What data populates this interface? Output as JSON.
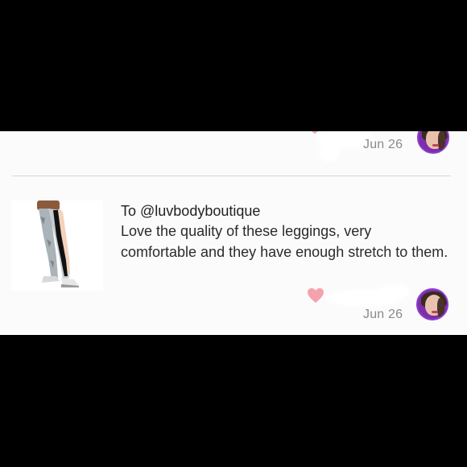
{
  "previous_review": {
    "date": "Jun 26"
  },
  "review": {
    "to_label": "To @luvbodyboutique",
    "text": "Love the quality of these leggings, very comfortable and they have enough stretch to them.",
    "date": "Jun 26"
  },
  "colors": {
    "heart": "#f4a3ac",
    "avatar_ring": "#8c3bd1",
    "divider": "#d9d9d9",
    "date_text": "#8a8a8a"
  },
  "icons": {
    "like": "heart-icon",
    "product": "leggings-thumbnail",
    "user": "avatar"
  }
}
